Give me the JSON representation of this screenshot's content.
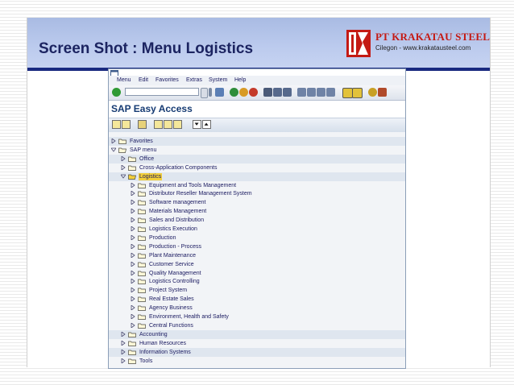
{
  "slide": {
    "title": "Screen Shot : Menu Logistics",
    "company_name": "PT KRAKATAU STEEL",
    "company_subtitle": "Cilegon - www.krakatausteel.com",
    "colors": {
      "title": "#1c2461",
      "company": "#c41a14",
      "rule": "#1a2a80"
    }
  },
  "sap": {
    "title_icon": "window-icon",
    "menu": [
      "Menu",
      "Edit",
      "Favorites",
      "Extras",
      "System",
      "Help"
    ],
    "command_field": {
      "value": ""
    },
    "toolbar_icons": [
      "enter-icon",
      "save-icon",
      "back-icon",
      "exit-icon",
      "cancel-icon",
      "print-icon",
      "find-icon",
      "find-next-icon",
      "first-page-icon",
      "prev-page-icon",
      "next-page-icon",
      "last-page-icon",
      "new-session-icon",
      "shortcut-icon",
      "help-icon",
      "layout-icon"
    ],
    "app_title": "SAP Easy Access",
    "app_toolbar_icons": [
      "user-menu-icon",
      "sap-menu-icon",
      "other-menu-icon",
      "add-favorite-icon",
      "delete-favorite-icon",
      "change-favorite-icon",
      "move-down-icon",
      "move-up-icon"
    ],
    "tree": [
      {
        "label": "Favorites",
        "level": 0,
        "expanded": false
      },
      {
        "label": "SAP menu",
        "level": 0,
        "expanded": true
      },
      {
        "label": "Office",
        "level": 1,
        "expanded": false
      },
      {
        "label": "Cross-Application Components",
        "level": 1,
        "expanded": false
      },
      {
        "label": "Logistics",
        "level": 1,
        "expanded": true,
        "selected": true
      },
      {
        "label": "Equipment and Tools Management",
        "level": 2,
        "expanded": false
      },
      {
        "label": "Distributor Reseller Management System",
        "level": 2,
        "expanded": false
      },
      {
        "label": "Software management",
        "level": 2,
        "expanded": false
      },
      {
        "label": "Materials Management",
        "level": 2,
        "expanded": false
      },
      {
        "label": "Sales and Distribution",
        "level": 2,
        "expanded": false
      },
      {
        "label": "Logistics Execution",
        "level": 2,
        "expanded": false
      },
      {
        "label": "Production",
        "level": 2,
        "expanded": false
      },
      {
        "label": "Production - Process",
        "level": 2,
        "expanded": false
      },
      {
        "label": "Plant Maintenance",
        "level": 2,
        "expanded": false
      },
      {
        "label": "Customer Service",
        "level": 2,
        "expanded": false
      },
      {
        "label": "Quality Management",
        "level": 2,
        "expanded": false
      },
      {
        "label": "Logistics Controlling",
        "level": 2,
        "expanded": false
      },
      {
        "label": "Project System",
        "level": 2,
        "expanded": false
      },
      {
        "label": "Real Estate Sales",
        "level": 2,
        "expanded": false
      },
      {
        "label": "Agency Business",
        "level": 2,
        "expanded": false
      },
      {
        "label": "Environment, Health and Safety",
        "level": 2,
        "expanded": false
      },
      {
        "label": "Central Functions",
        "level": 2,
        "expanded": false
      },
      {
        "label": "Accounting",
        "level": 1,
        "expanded": false
      },
      {
        "label": "Human Resources",
        "level": 1,
        "expanded": false
      },
      {
        "label": "Information Systems",
        "level": 1,
        "expanded": false
      },
      {
        "label": "Tools",
        "level": 1,
        "expanded": false
      }
    ]
  }
}
